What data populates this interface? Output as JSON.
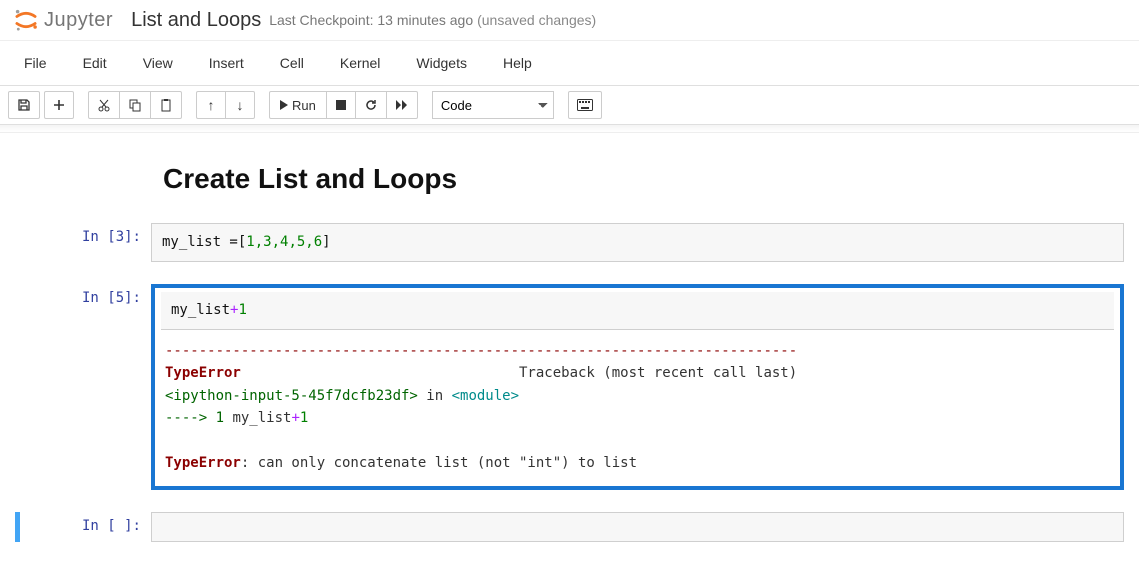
{
  "header": {
    "logo_text": "Jupyter",
    "notebook_title": "List and Loops",
    "checkpoint": "Last Checkpoint: 13 minutes ago",
    "unsaved": "(unsaved changes)"
  },
  "menu": {
    "file": "File",
    "edit": "Edit",
    "view": "View",
    "insert": "Insert",
    "cell": "Cell",
    "kernel": "Kernel",
    "widgets": "Widgets",
    "help": "Help"
  },
  "toolbar": {
    "run_label": "Run",
    "cell_type": "Code"
  },
  "content": {
    "heading": "Create List and Loops",
    "cell1": {
      "prompt": "In [3]:",
      "code_pre": "my_list =[",
      "code_nums": "1,3,4,5,6",
      "code_post": "]"
    },
    "cell2": {
      "prompt": "In [5]:",
      "code_var": "my_list",
      "code_op": "+",
      "code_num": "1",
      "err_dashes": "---------------------------------------------------------------------------",
      "err_type1": "TypeError",
      "err_traceback": "                                 Traceback (most recent call last)",
      "err_ipy": "<ipython-input-5-45f7dcfb23df>",
      "err_in": " in ",
      "err_module": "<module>",
      "err_arrow": "----> 1",
      "err_line": " my_list",
      "err_lineop": "+",
      "err_linenum": "1",
      "err_type2": "TypeError",
      "err_msg": ": can only concatenate list (not \"int\") to list"
    },
    "cell3": {
      "prompt": "In [ ]:",
      "code": ""
    }
  }
}
